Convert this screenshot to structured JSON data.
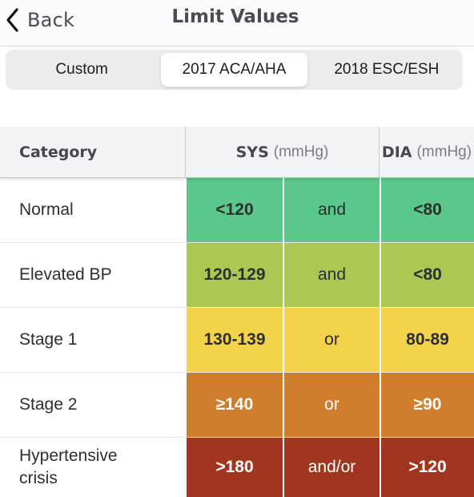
{
  "navbar": {
    "back_label": "Back",
    "title": "Limit Values"
  },
  "segments": {
    "items": [
      {
        "label": "Custom",
        "active": false
      },
      {
        "label": "2017 ACA/AHA",
        "active": true
      },
      {
        "label": "2018 ESC/ESH",
        "active": false
      }
    ]
  },
  "table": {
    "headers": {
      "category": "Category",
      "sys": "SYS",
      "sys_unit": "(mmHg)",
      "dia": "DIA",
      "dia_unit": "(mmHg)"
    },
    "rows": [
      {
        "category": "Normal",
        "sys": "<120",
        "operator": "and",
        "dia": "<80",
        "color": "#5ac88a",
        "text_color": "#2c2e33"
      },
      {
        "category": "Elevated BP",
        "sys": "120-129",
        "operator": "and",
        "dia": "<80",
        "color": "#abc952",
        "text_color": "#2c2e33"
      },
      {
        "category": "Stage 1",
        "sys": "130-139",
        "operator": "or",
        "dia": "80-89",
        "color": "#f4d24c",
        "text_color": "#2c2e33"
      },
      {
        "category": "Stage 2",
        "sys": "≥140",
        "operator": "or",
        "dia": "≥90",
        "color": "#d07d2c",
        "text_color": "#ffffff"
      },
      {
        "category": "Hypertensive crisis",
        "sys": ">180",
        "operator": "and/or",
        "dia": ">120",
        "color": "#a2351f",
        "text_color": "#ffffff"
      }
    ]
  }
}
